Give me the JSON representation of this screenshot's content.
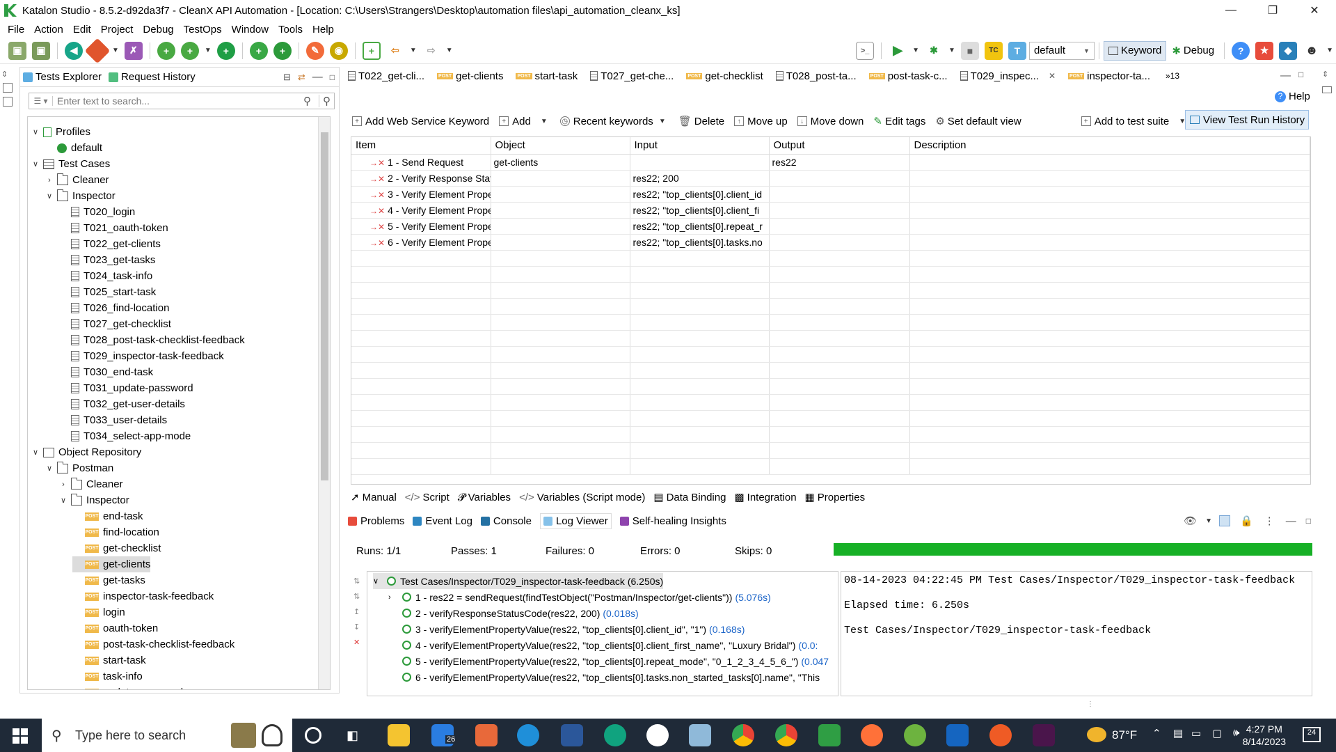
{
  "window": {
    "title": "Katalon Studio - 8.5.2-d92da3f7 - CleanX API Automation - [Location: C:\\Users\\Strangers\\Desktop\\automation files\\api_automation_cleanx_ks]"
  },
  "menu": [
    "File",
    "Action",
    "Edit",
    "Project",
    "Debug",
    "TestOps",
    "Window",
    "Tools",
    "Help"
  ],
  "toolbar": {
    "profile_select": "default",
    "keyword_label": "Keyword",
    "debug_label": "Debug"
  },
  "left_panel": {
    "tabs": [
      "Tests Explorer",
      "Request History"
    ],
    "search_placeholder": "Enter text to search...",
    "tree": {
      "profiles": "Profiles",
      "profile_default": "default",
      "test_cases": "Test Cases",
      "cleaner": "Cleaner",
      "inspector": "Inspector",
      "test_items": [
        "T020_login",
        "T021_oauth-token",
        "T022_get-clients",
        "T023_get-tasks",
        "T024_task-info",
        "T025_start-task",
        "T026_find-location",
        "T027_get-checklist",
        "T028_post-task-checklist-feedback",
        "T029_inspector-task-feedback",
        "T030_end-task",
        "T031_update-password",
        "T032_get-user-details",
        "T033_user-details",
        "T034_select-app-mode"
      ],
      "object_repository": "Object Repository",
      "postman": "Postman",
      "or_cleaner": "Cleaner",
      "or_inspector": "Inspector",
      "requests": [
        "end-task",
        "find-location",
        "get-checklist",
        "get-clients",
        "get-tasks",
        "inspector-task-feedback",
        "login",
        "oauth-token",
        "post-task-checklist-feedback",
        "start-task",
        "task-info",
        "update-password"
      ],
      "post_badge": "POST"
    }
  },
  "editor_tabs": [
    {
      "label": "T022_get-cli...",
      "kind": "tc"
    },
    {
      "label": "get-clients",
      "kind": "post"
    },
    {
      "label": "start-task",
      "kind": "post"
    },
    {
      "label": "T027_get-che...",
      "kind": "tc"
    },
    {
      "label": "get-checklist",
      "kind": "post"
    },
    {
      "label": "T028_post-ta...",
      "kind": "tc"
    },
    {
      "label": "post-task-c...",
      "kind": "post"
    },
    {
      "label": "T029_inspec...",
      "kind": "tc"
    },
    {
      "label": "inspector-ta...",
      "kind": "post"
    }
  ],
  "editor_overflow": "»13",
  "help_label": "Help",
  "actions": {
    "add_ws_keyword": "Add Web Service Keyword",
    "add": "Add",
    "recent": "Recent keywords",
    "delete": "Delete",
    "move_up": "Move up",
    "move_down": "Move down",
    "edit_tags": "Edit tags",
    "set_default_view": "Set default view",
    "add_to_suite": "Add to test suite",
    "view_history": "View Test Run History"
  },
  "grid": {
    "headers": [
      "Item",
      "Object",
      "Input",
      "Output",
      "Description"
    ],
    "rows": [
      {
        "item": "1 - Send Request",
        "object": "get-clients",
        "input": "",
        "output": "res22"
      },
      {
        "item": "2 - Verify Response Stat",
        "object": "",
        "input": "res22; 200",
        "output": ""
      },
      {
        "item": "3 - Verify Element Prope",
        "object": "",
        "input": "res22; \"top_clients[0].client_id",
        "output": ""
      },
      {
        "item": "4 - Verify Element Prope",
        "object": "",
        "input": "res22; \"top_clients[0].client_fi",
        "output": ""
      },
      {
        "item": "5 - Verify Element Prope",
        "object": "",
        "input": "res22; \"top_clients[0].repeat_r",
        "output": ""
      },
      {
        "item": "6 - Verify Element Prope",
        "object": "",
        "input": "res22; \"top_clients[0].tasks.no",
        "output": ""
      }
    ]
  },
  "editor_bottom_tabs": [
    "Manual",
    "Script",
    "Variables",
    "Variables (Script mode)",
    "Data Binding",
    "Integration",
    "Properties"
  ],
  "console_tabs": [
    "Problems",
    "Event Log",
    "Console",
    "Log Viewer",
    "Self-healing Insights"
  ],
  "stats": {
    "runs": "Runs: 1/1",
    "passes": "Passes: 1",
    "failures": "Failures: 0",
    "errors": "Errors: 0",
    "skips": "Skips: 0",
    "progress": 1.0
  },
  "log_tree": {
    "root": "Test Cases/Inspector/T029_inspector-task-feedback (6.250s)",
    "steps": [
      {
        "text": "1 - res22 = sendRequest(findTestObject(\"Postman/Inspector/get-clients\"))",
        "dur": "(5.076s)"
      },
      {
        "text": "2 - verifyResponseStatusCode(res22, 200)",
        "dur": "(0.018s)"
      },
      {
        "text": "3 - verifyElementPropertyValue(res22, \"top_clients[0].client_id\", \"1\")",
        "dur": "(0.168s)"
      },
      {
        "text": "4 - verifyElementPropertyValue(res22, \"top_clients[0].client_first_name\", \"Luxury Bridal\")",
        "dur": "(0.0:"
      },
      {
        "text": "5 - verifyElementPropertyValue(res22, \"top_clients[0].repeat_mode\", \"0_1_2_3_4_5_6_\")",
        "dur": "(0.047"
      },
      {
        "text": "6 - verifyElementPropertyValue(res22, \"top_clients[0].tasks.non_started_tasks[0].name\", \"This",
        "dur": ""
      }
    ]
  },
  "log_detail": [
    "08-14-2023 04:22:45 PM Test Cases/Inspector/T029_inspector-task-feedback",
    "Elapsed time: 6.250s",
    "Test Cases/Inspector/T029_inspector-task-feedback"
  ],
  "taskbar": {
    "search_placeholder": "Type here to search",
    "mail_badge": "26",
    "weather": "87°F",
    "time": "4:27 PM",
    "date": "8/14/2023",
    "notif_count": "24"
  },
  "colors": {
    "accent": "#17b026",
    "brand": "#2c9a3a",
    "post": "#f0b94a",
    "taskbar": "#1f2a38"
  }
}
